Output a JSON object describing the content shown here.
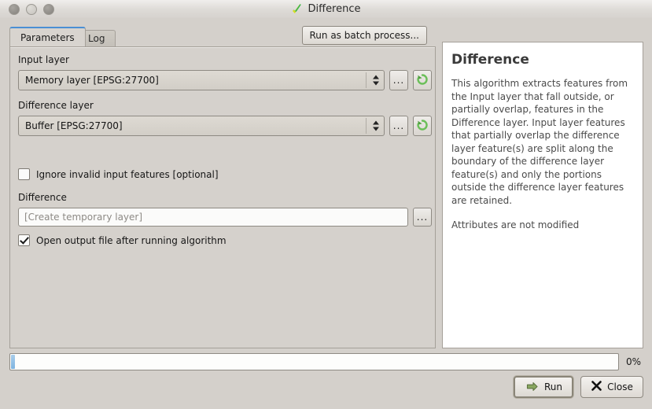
{
  "window": {
    "title": "Difference",
    "app_icon": "qgis-processing-icon",
    "controls": {
      "close": "close-button",
      "minimize": "minimize-button",
      "maximize": "maximize-button"
    }
  },
  "tabs": [
    {
      "label": "Parameters",
      "active": true
    },
    {
      "label": "Log",
      "active": false
    }
  ],
  "toolbar": {
    "batch_label": "Run as batch process..."
  },
  "params": {
    "input_layer": {
      "label": "Input layer",
      "value": "Memory layer [EPSG:27700]",
      "browse_label": "...",
      "iterate_icon": "iterate-features-icon"
    },
    "difference_layer": {
      "label": "Difference layer",
      "value": "Buffer [EPSG:27700]",
      "browse_label": "...",
      "iterate_icon": "iterate-features-icon"
    },
    "ignore_invalid": {
      "label": "Ignore invalid input features [optional]",
      "checked": false
    },
    "output": {
      "label": "Difference",
      "value": "[Create temporary layer]",
      "browse_label": "..."
    },
    "open_output": {
      "label": "Open output file after running algorithm",
      "checked": true
    }
  },
  "help": {
    "title": "Difference",
    "paragraph1": "This algorithm extracts features from the Input layer that fall outside, or partially overlap, features in the Difference layer. Input layer features that partially overlap the difference layer feature(s) are split along the boundary of the difference layer feature(s) and only the portions outside the difference layer features are retained.",
    "paragraph2": "Attributes are not modified"
  },
  "progress": {
    "percent_label": "0%",
    "value": 0
  },
  "actions": {
    "run_label": "Run",
    "run_icon": "green-arrow-icon",
    "close_label": "Close",
    "close_icon": "x-icon"
  },
  "colors": {
    "window_bg": "#d4d0cb",
    "panel_bg": "#d5d1cc",
    "help_bg": "#ffffff",
    "accent_tab": "#4a8fd4",
    "progress_fill": "#7fb4e0",
    "run_icon_green": "#7a9a55"
  }
}
